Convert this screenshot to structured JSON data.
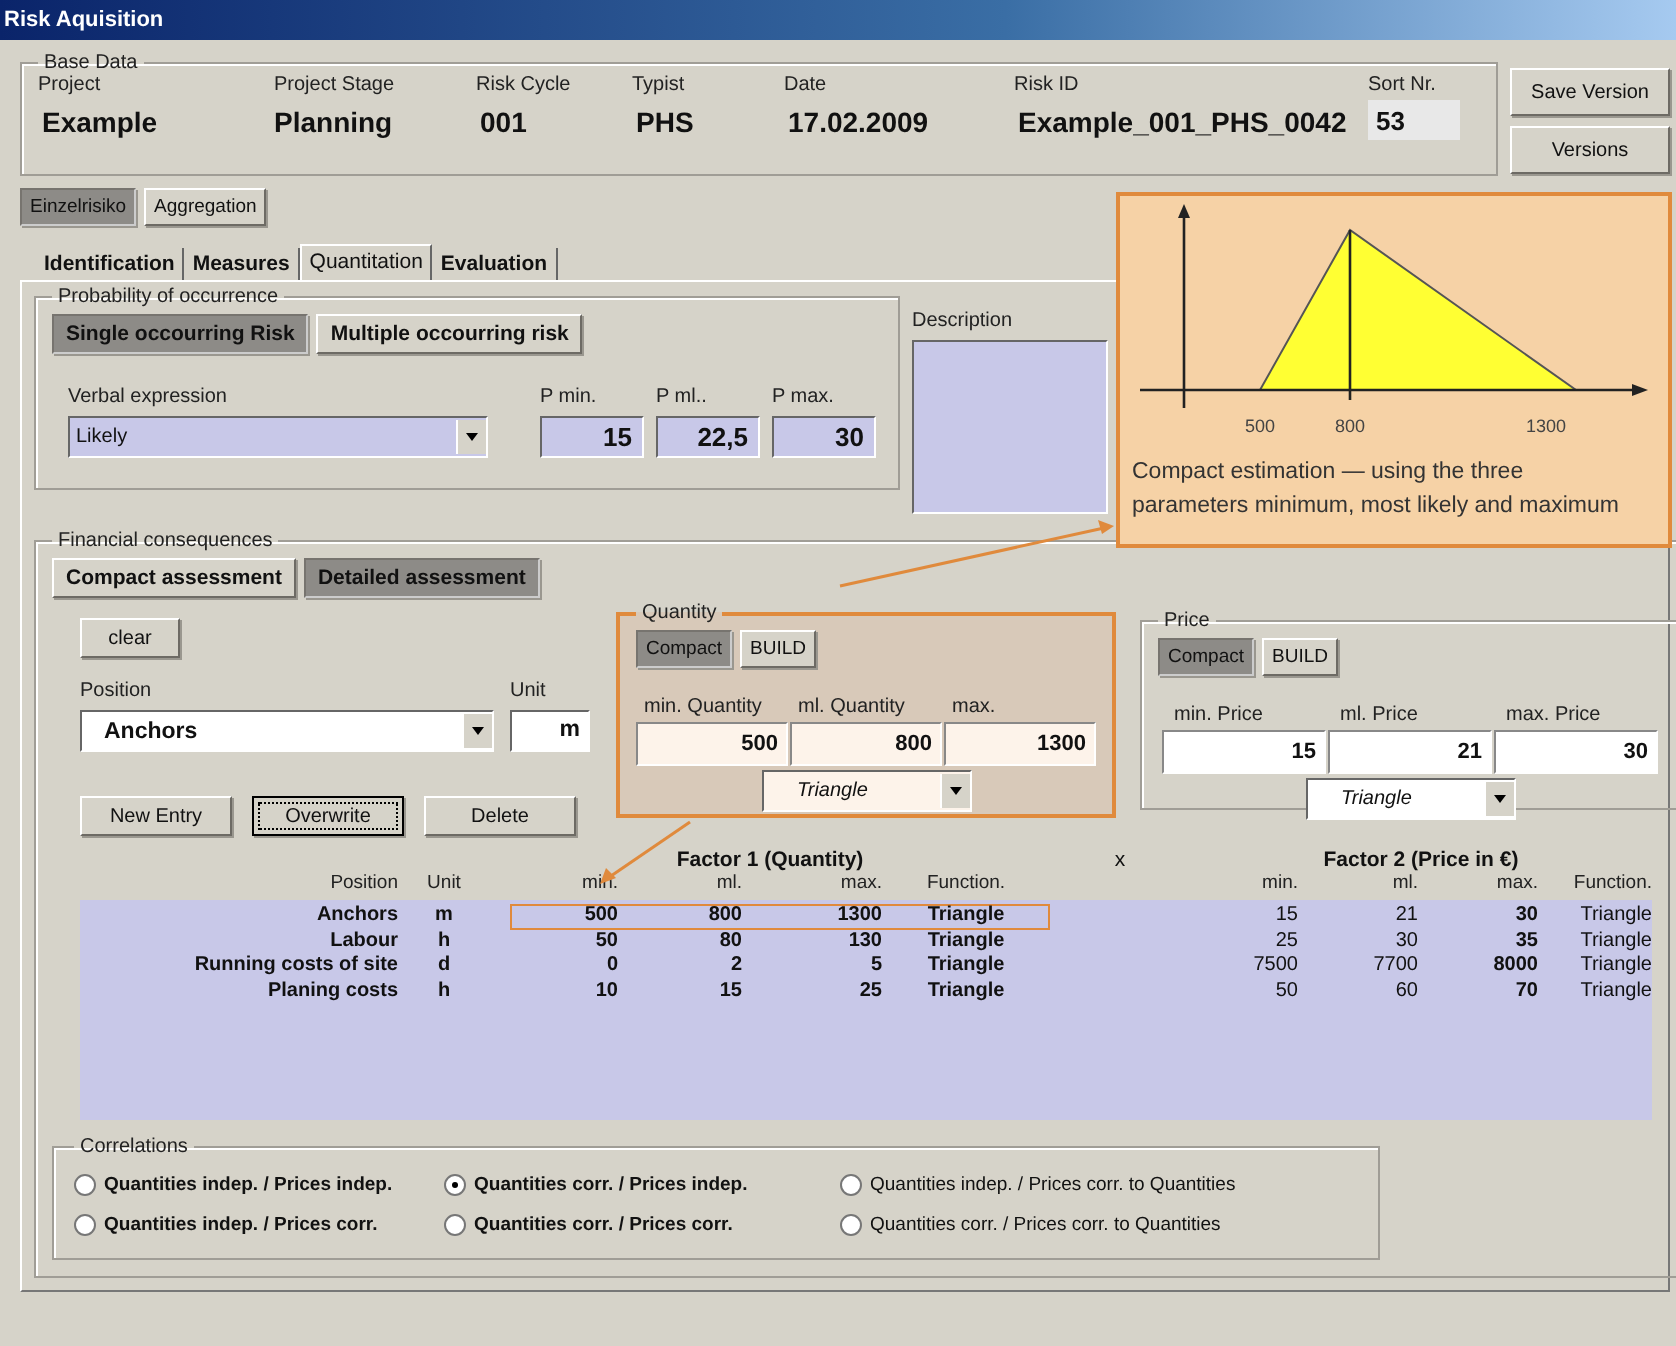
{
  "window": {
    "title": "Risk Aquisition"
  },
  "base_data": {
    "legend": "Base Data",
    "fields": [
      {
        "label": "Project",
        "value": "Example"
      },
      {
        "label": "Project Stage",
        "value": "Planning"
      },
      {
        "label": "Risk Cycle",
        "value": "001"
      },
      {
        "label": "Typist",
        "value": "PHS"
      },
      {
        "label": "Date",
        "value": "17.02.2009"
      },
      {
        "label": "Risk ID",
        "value": "Example_001_PHS_0042"
      }
    ],
    "sort": {
      "label": "Sort Nr.",
      "value": "53"
    }
  },
  "side_buttons": [
    "Save Version",
    "Versions"
  ],
  "mode_tabs": [
    {
      "label": "Einzelrisiko",
      "selected": true
    },
    {
      "label": "Aggregation",
      "selected": false
    }
  ],
  "tabs": [
    {
      "label": "Identification",
      "selected": false
    },
    {
      "label": "Measures",
      "selected": false
    },
    {
      "label": "Quantitation",
      "selected": true
    },
    {
      "label": "Evaluation",
      "selected": false
    }
  ],
  "probability": {
    "legend": "Probability of occurrence",
    "types": [
      {
        "label": "Single occourring Risk",
        "selected": true
      },
      {
        "label": "Multiple occourring risk",
        "selected": false
      }
    ],
    "verbal": {
      "label": "Verbal expression",
      "value": "Likely"
    },
    "p_fields": [
      {
        "label": "P min.",
        "value": "15"
      },
      {
        "label": "P ml..",
        "value": "22,5"
      },
      {
        "label": "P max.",
        "value": "30"
      }
    ]
  },
  "description": {
    "label": "Description"
  },
  "financial": {
    "legend": "Financial consequences",
    "modes": [
      {
        "label": "Compact assessment",
        "selected": false
      },
      {
        "label": "Detailed assessment",
        "selected": true
      }
    ],
    "clear": "clear",
    "position": {
      "label": "Position",
      "value": "Anchors"
    },
    "unit": {
      "label": "Unit",
      "value": "m"
    },
    "actions": [
      {
        "label": "New Entry",
        "focused": false
      },
      {
        "label": "Overwrite",
        "focused": true
      },
      {
        "label": "Delete",
        "focused": false
      }
    ],
    "quantity": {
      "legend": "Quantity",
      "highlighted": true,
      "modes": [
        {
          "label": "Compact",
          "selected": true
        },
        {
          "label": "BUILD",
          "selected": false
        }
      ],
      "fields": [
        {
          "label": "min. Quantity",
          "value": "500"
        },
        {
          "label": "ml. Quantity",
          "value": "800"
        },
        {
          "label": "max.",
          "value": "1300"
        }
      ],
      "function": "Triangle"
    },
    "price": {
      "legend": "Price",
      "highlighted": false,
      "modes": [
        {
          "label": "Compact",
          "selected": true
        },
        {
          "label": "BUILD",
          "selected": false
        }
      ],
      "fields": [
        {
          "label": "min. Price",
          "value": "15"
        },
        {
          "label": "ml. Price",
          "value": "21"
        },
        {
          "label": "max. Price",
          "value": "30"
        }
      ],
      "function": "Triangle"
    }
  },
  "table": {
    "factor1": "Factor 1 (Quantity)",
    "operator": "x",
    "factor2": "Factor 2 (Price in €)",
    "columns": [
      "Position",
      "Unit",
      "min.",
      "ml.",
      "max.",
      "Function.",
      "min.",
      "ml.",
      "max.",
      "Function."
    ],
    "rows": [
      {
        "highlighted": true,
        "cells": [
          "Anchors",
          "m",
          "500",
          "800",
          "1300",
          "Triangle",
          "15",
          "21",
          "30",
          "Triangle"
        ]
      },
      {
        "highlighted": false,
        "cells": [
          "Labour",
          "h",
          "50",
          "80",
          "130",
          "Triangle",
          "25",
          "30",
          "35",
          "Triangle"
        ]
      },
      {
        "highlighted": false,
        "cells": [
          "Running costs of site",
          "d",
          "0",
          "2",
          "5",
          "Triangle",
          "7500",
          "7700",
          "8000",
          "Triangle"
        ]
      },
      {
        "highlighted": false,
        "cells": [
          "Planing costs",
          "h",
          "10",
          "15",
          "25",
          "Triangle",
          "50",
          "60",
          "70",
          "Triangle"
        ]
      }
    ]
  },
  "correlations": {
    "legend": "Correlations",
    "options": [
      {
        "label": "Quantities indep. / Prices indep.",
        "selected": false
      },
      {
        "label": "Quantities corr. / Prices indep.",
        "selected": true
      },
      {
        "label": "Quantities indep. / Prices corr. to Quantities",
        "selected": false
      },
      {
        "label": "Quantities indep. / Prices corr.",
        "selected": false
      },
      {
        "label": "Quantities corr. / Prices corr.",
        "selected": false
      },
      {
        "label": "Quantities corr. / Prices corr. to Quantities",
        "selected": false
      }
    ]
  },
  "callout": {
    "ticks": [
      "500",
      "800",
      "1300"
    ],
    "caption": "Compact estimation — using the three parameters minimum, most likely and maximum"
  }
}
